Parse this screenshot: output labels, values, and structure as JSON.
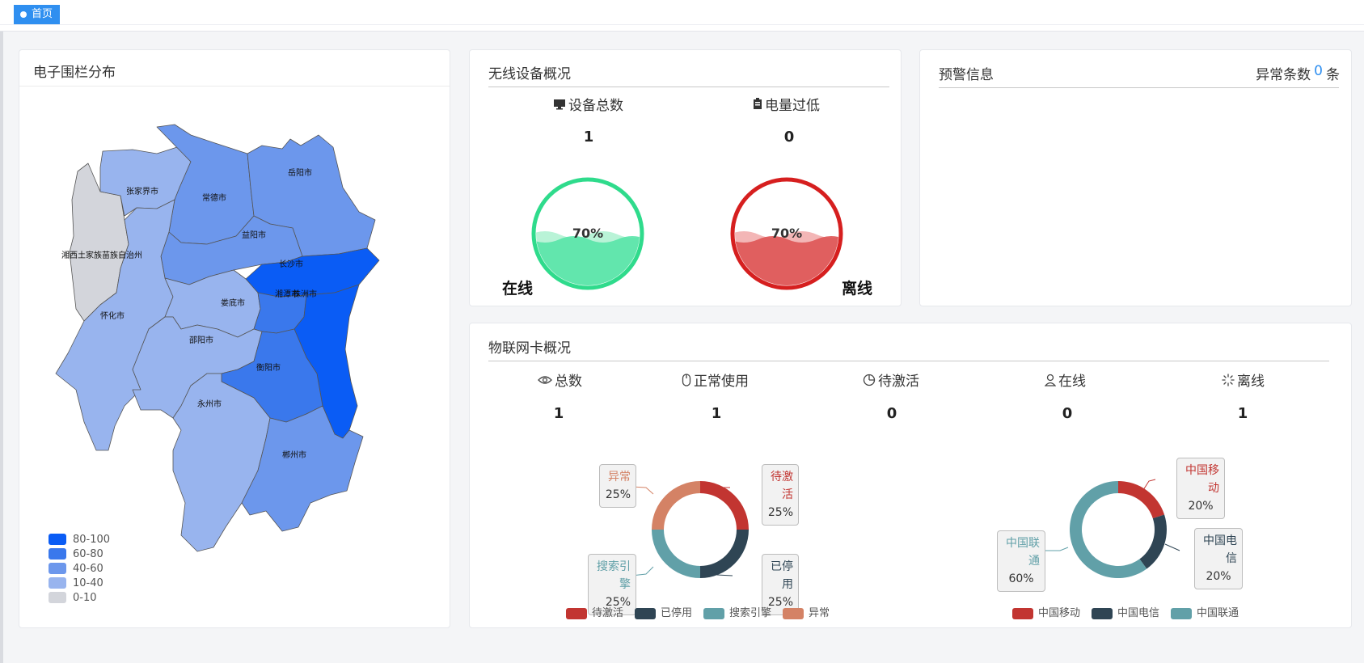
{
  "tab": {
    "label": "首页"
  },
  "map_card": {
    "title": "电子围栏分布",
    "cities": [
      {
        "name": "张家界市",
        "color": "#98b4ee"
      },
      {
        "name": "常德市",
        "color": "#6c97ec"
      },
      {
        "name": "岳阳市",
        "color": "#6c97ec"
      },
      {
        "name": "益阳市",
        "color": "#6c97ec"
      },
      {
        "name": "湘西土家族苗族自治州",
        "color": "#d3d5db"
      },
      {
        "name": "长沙市",
        "color": "#0a5cf5"
      },
      {
        "name": "怀化市",
        "color": "#98b4ee"
      },
      {
        "name": "娄底市",
        "color": "#98b4ee"
      },
      {
        "name": "湘潭市",
        "color": "#3a78ec"
      },
      {
        "name": "株洲市",
        "color": "#0a5cf5"
      },
      {
        "name": "邵阳市",
        "color": "#98b4ee"
      },
      {
        "name": "衡阳市",
        "color": "#3a78ec"
      },
      {
        "name": "永州市",
        "color": "#98b4ee"
      },
      {
        "name": "郴州市",
        "color": "#6c97ec"
      }
    ],
    "legend": [
      {
        "label": "80-100",
        "color": "#0a5cf5"
      },
      {
        "label": "60-80",
        "color": "#3a78ec"
      },
      {
        "label": "40-60",
        "color": "#6c97ec"
      },
      {
        "label": "10-40",
        "color": "#98b4ee"
      },
      {
        "label": "0-10",
        "color": "#d3d5db"
      }
    ]
  },
  "wireless": {
    "title": "无线设备概况",
    "total_label": "设备总数",
    "total_value": "1",
    "lowbat_label": "电量过低",
    "lowbat_value": "0",
    "online_label": "在线",
    "online_percent": "70%",
    "offline_label": "离线",
    "offline_percent": "70%",
    "online_color": "#2fdb8c",
    "offline_color": "#d61f1f"
  },
  "alert": {
    "title": "预警信息",
    "count_prefix": "异常条数",
    "count_value": "0",
    "count_suffix": "条"
  },
  "iot": {
    "title": "物联网卡概况",
    "stats": [
      {
        "label": "总数",
        "value": "1",
        "icon": "eye-icon"
      },
      {
        "label": "正常使用",
        "value": "1",
        "icon": "mouse-icon"
      },
      {
        "label": "待激活",
        "value": "0",
        "icon": "pie-icon"
      },
      {
        "label": "在线",
        "value": "0",
        "icon": "user-icon"
      },
      {
        "label": "离线",
        "value": "1",
        "icon": "loading-icon"
      }
    ]
  },
  "chart_data": [
    {
      "type": "pie",
      "donut": true,
      "categories": [
        "待激活",
        "已停用",
        "搜索引擎",
        "异常"
      ],
      "values": [
        25,
        25,
        25,
        25
      ],
      "colors": [
        "#c23531",
        "#2f4554",
        "#61a0a8",
        "#d48265"
      ],
      "value_labels": [
        "25%",
        "25%",
        "25%",
        "25%"
      ],
      "legend": "bottom"
    },
    {
      "type": "pie",
      "donut": true,
      "categories": [
        "中国移动",
        "中国电信",
        "中国联通"
      ],
      "values": [
        20,
        20,
        60
      ],
      "colors": [
        "#c23531",
        "#2f4554",
        "#61a0a8"
      ],
      "value_labels": [
        "20%",
        "20%",
        "60%"
      ],
      "legend": "bottom"
    }
  ]
}
